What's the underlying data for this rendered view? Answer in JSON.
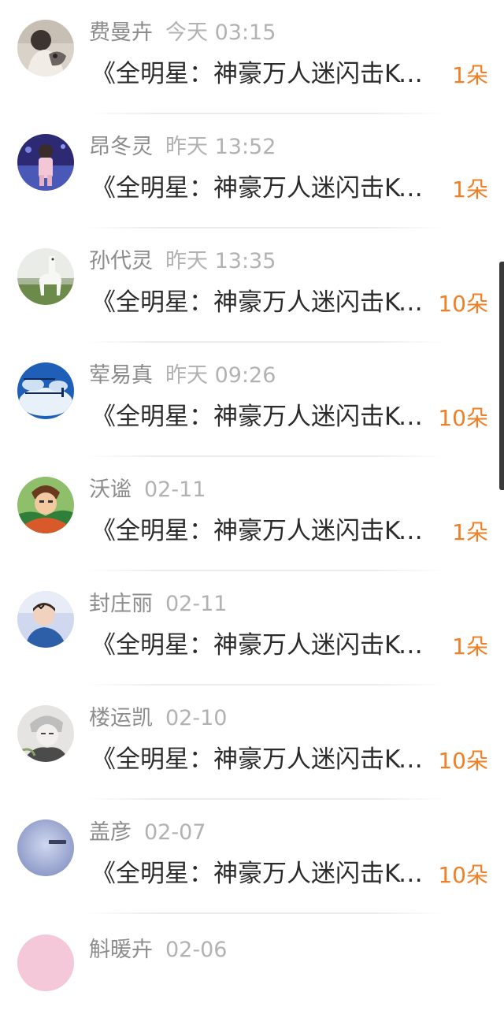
{
  "items": [
    {
      "name": "费曼卉",
      "time": "今天 03:15",
      "title": "《全明星：神豪万人迷闪击KTV》",
      "count": "1朵",
      "avatar_icon": "girl-with-cat-icon"
    },
    {
      "name": "昂冬灵",
      "time": "昨天 13:52",
      "title": "《全明星：神豪万人迷闪击KTV》",
      "count": "1朵",
      "avatar_icon": "girl-in-field-icon"
    },
    {
      "name": "孙代灵",
      "time": "昨天 13:35",
      "title": "《全明星：神豪万人迷闪击KTV》",
      "count": "10朵",
      "avatar_icon": "alpaca-icon"
    },
    {
      "name": "荤易真",
      "time": "昨天 09:26",
      "title": "《全明星：神豪万人迷闪击KTV》",
      "count": "10朵",
      "avatar_icon": "blue-sky-text-icon"
    },
    {
      "name": "沃谧",
      "time": "02-11",
      "title": "《全明星：神豪万人迷闪击KTV》",
      "count": "1朵",
      "avatar_icon": "anime-character-icon"
    },
    {
      "name": "封庄丽",
      "time": "02-11",
      "title": "《全明星：神豪万人迷闪击KTV》",
      "count": "1朵",
      "avatar_icon": "kid-photo-icon"
    },
    {
      "name": "楼运凯",
      "time": "02-10",
      "title": "《全明星：神豪万人迷闪击KTV》",
      "count": "10朵",
      "avatar_icon": "anime-sketch-icon"
    },
    {
      "name": "盖彦",
      "time": "02-07",
      "title": "《全明星：神豪万人迷闪击KTV》",
      "count": "10朵",
      "avatar_icon": "blue-moon-icon"
    },
    {
      "name": "斛暖卉",
      "time": "02-06",
      "title": "",
      "count": "",
      "avatar_icon": "pink-avatar-icon"
    }
  ],
  "colors": {
    "name": "#8c8c8c",
    "time": "#b2b2b2",
    "title": "#2b2b2b",
    "count": "#f07f26"
  }
}
